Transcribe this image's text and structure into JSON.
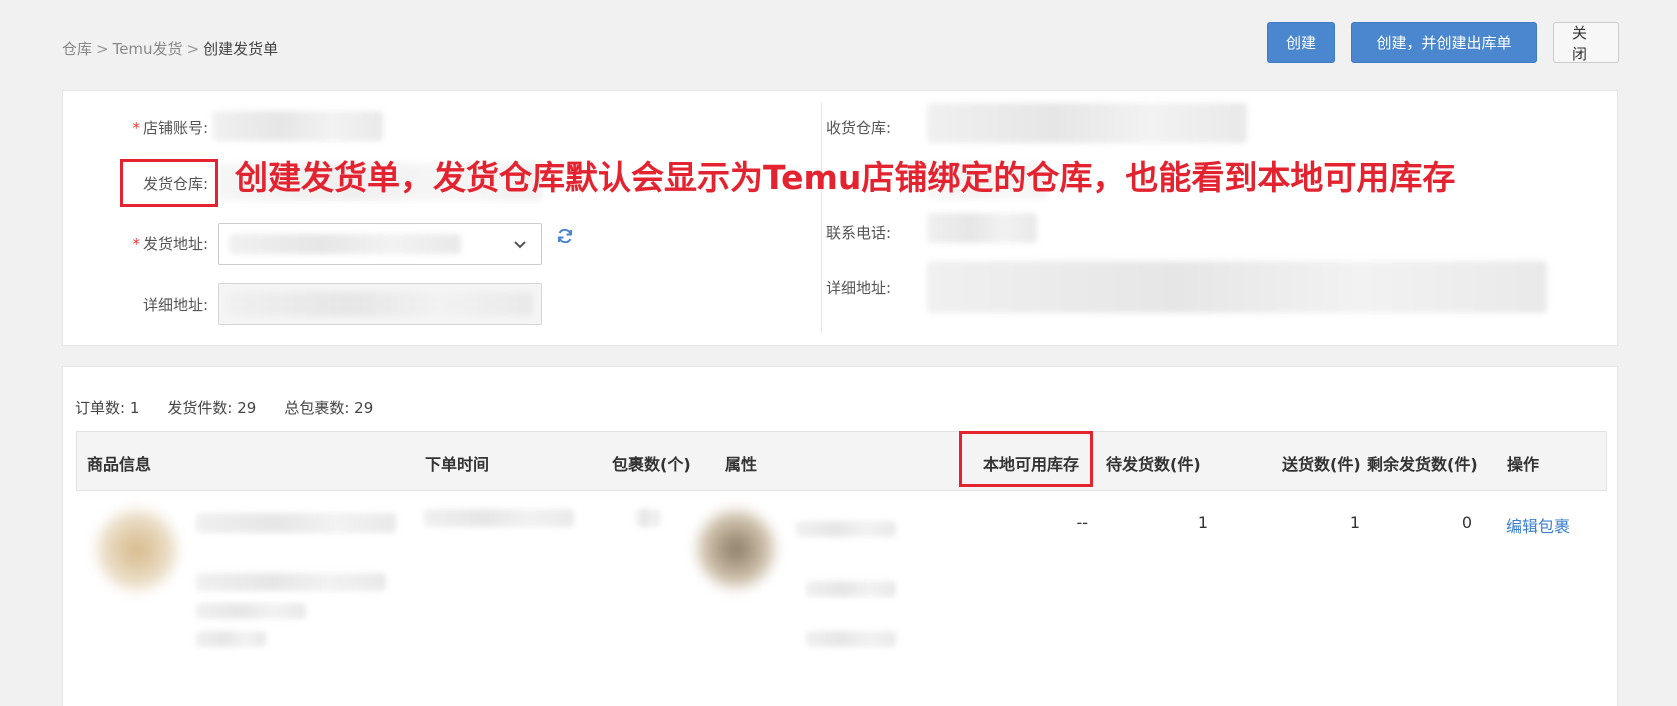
{
  "breadcrumb": {
    "items": [
      "仓库",
      "Temu发货",
      "创建发货单"
    ],
    "separator": ">"
  },
  "toolbar": {
    "create_label": "创建",
    "create_outbound_label": "创建，并创建出库单",
    "close_label": "关闭"
  },
  "form": {
    "shop_account_label": "店铺账号:",
    "ship_warehouse_label": "发货仓库:",
    "ship_address_label": "发货地址:",
    "detail_address_label": "详细地址:",
    "receive_warehouse_label": "收货仓库:",
    "contact_phone_label": "联系电话:",
    "receive_detail_address_label": "详细地址:"
  },
  "annotation": {
    "text": "创建发货单，发货仓库默认会显示为Temu店铺绑定的仓库，也能看到本地可用库存"
  },
  "summary": {
    "orders_label": "订单数:",
    "orders_value": "1",
    "items_label": "发货件数:",
    "items_value": "29",
    "packages_label": "总包裹数:",
    "packages_value": "29"
  },
  "table": {
    "columns": [
      "商品信息",
      "下单时间",
      "包裹数(个)",
      "属性",
      "本地可用库存",
      "待发货数(件)",
      "送货数(件)",
      "剩余发货数(件)",
      "操作"
    ],
    "rows": [
      {
        "local_stock": "--",
        "pending": "1",
        "delivered": "1",
        "remaining": "0",
        "action": "编辑包裹"
      }
    ]
  },
  "colors": {
    "primary": "#4b87cf",
    "highlight": "#e3232f",
    "link": "#3a7fd0"
  }
}
